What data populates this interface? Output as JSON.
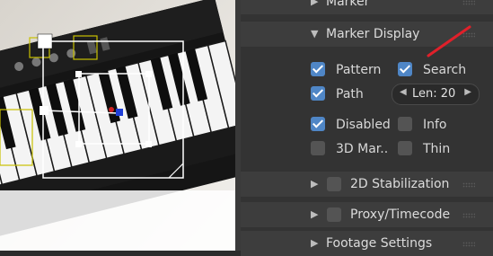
{
  "viewer": {
    "label": "clip viewer"
  },
  "panel": {
    "marker_section": {
      "label": "Marker"
    },
    "marker_display": {
      "label": "Marker Display",
      "options": {
        "pattern": {
          "label": "Pattern",
          "checked": true
        },
        "search": {
          "label": "Search",
          "checked": true
        },
        "path": {
          "label": "Path",
          "checked": true
        },
        "length": {
          "label": "Len: 20",
          "value": 20
        },
        "disabled": {
          "label": "Disabled",
          "checked": true
        },
        "info": {
          "label": "Info",
          "checked": false
        },
        "three_d_markers": {
          "label": "3D Mar..",
          "checked": false
        },
        "thin": {
          "label": "Thin",
          "checked": false
        }
      }
    },
    "stabilization": {
      "label": "2D Stabilization",
      "enabled": false
    },
    "proxy": {
      "label": "Proxy/Timecode",
      "enabled": false
    },
    "footage": {
      "label": "Footage Settings"
    }
  },
  "colors": {
    "accent": "#4f86c6",
    "annotation": "#e0202a"
  }
}
